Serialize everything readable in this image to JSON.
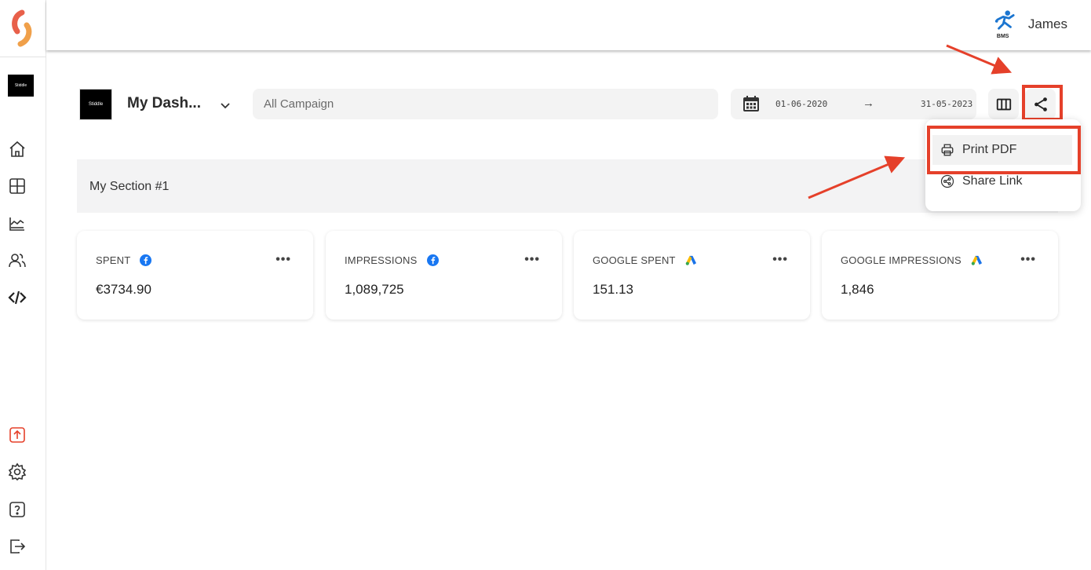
{
  "sidebar": {
    "brand_text": "Stiddle",
    "icons": [
      "home-icon",
      "layout-icon",
      "chart-area-icon",
      "users-icon",
      "code-icon",
      "upload-icon",
      "settings-icon",
      "help-icon",
      "logout-icon"
    ]
  },
  "header": {
    "user_name": "James",
    "user_logo_text": "BMS"
  },
  "toolbar": {
    "dashboard_logo_text": "Stiddle",
    "dashboard_title": "My Dash...",
    "campaign_value": "All Campaign",
    "date_from": "01-06-2020",
    "date_arrow": "→",
    "date_to": "31-05-2023"
  },
  "section": {
    "title": "My Section #1"
  },
  "cards": [
    {
      "label": "SPENT",
      "source": "facebook-icon",
      "value": "€3734.90"
    },
    {
      "label": "IMPRESSIONS",
      "source": "facebook-icon",
      "value": "1,089,725"
    },
    {
      "label": "GOOGLE SPENT",
      "source": "google-ads-icon",
      "value": "151.13"
    },
    {
      "label": "GOOGLE IMPRESSIONS",
      "source": "google-ads-icon",
      "value": "1,846"
    }
  ],
  "card_more": "•••",
  "share_menu": {
    "items": [
      {
        "label": "Print PDF",
        "icon": "printer-icon"
      },
      {
        "label": "Share Link",
        "icon": "share-link-icon"
      }
    ]
  },
  "colors": {
    "accent_red": "#e5402a",
    "facebook_blue": "#1877f2",
    "surface_gray": "#f3f3f3"
  }
}
